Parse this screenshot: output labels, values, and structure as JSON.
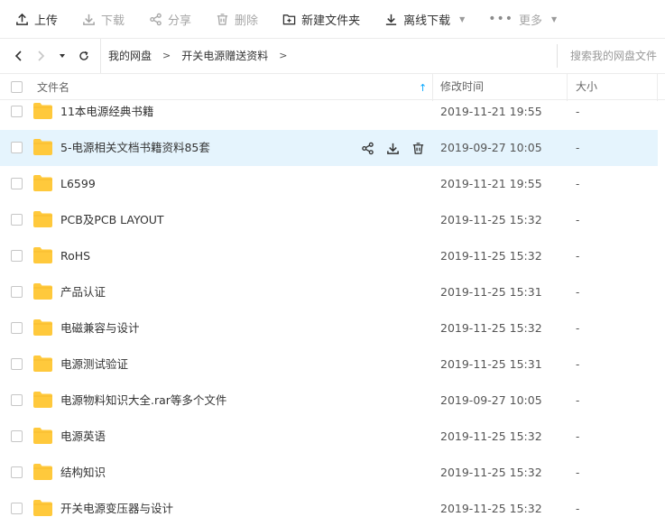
{
  "toolbar": {
    "upload": "上传",
    "download": "下载",
    "share": "分享",
    "delete": "删除",
    "new_folder": "新建文件夹",
    "offline_download": "离线下载",
    "more": "更多"
  },
  "nav": {
    "breadcrumb": [
      "我的网盘",
      "开关电源赠送资料"
    ],
    "search_placeholder": "搜索我的网盘文件"
  },
  "table": {
    "columns": {
      "name": "文件名",
      "mtime": "修改时间",
      "size": "大小"
    },
    "sort_arrow": "↑",
    "rows": [
      {
        "name": "11本电源经典书籍",
        "mtime": "2019-11-21 19:55",
        "size": "-"
      },
      {
        "name": "5-电源相关文档书籍资料85套",
        "mtime": "2019-09-27 10:05",
        "size": "-"
      },
      {
        "name": "L6599",
        "mtime": "2019-11-21 19:55",
        "size": "-"
      },
      {
        "name": "PCB及PCB LAYOUT",
        "mtime": "2019-11-25 15:32",
        "size": "-"
      },
      {
        "name": "RoHS",
        "mtime": "2019-11-25 15:32",
        "size": "-"
      },
      {
        "name": "产品认证",
        "mtime": "2019-11-25 15:31",
        "size": "-"
      },
      {
        "name": "电磁兼容与设计",
        "mtime": "2019-11-25 15:32",
        "size": "-"
      },
      {
        "name": "电源测试验证",
        "mtime": "2019-11-25 15:31",
        "size": "-"
      },
      {
        "name": "电源物料知识大全.rar等多个文件",
        "mtime": "2019-09-27 10:05",
        "size": "-"
      },
      {
        "name": "电源英语",
        "mtime": "2019-11-25 15:32",
        "size": "-"
      },
      {
        "name": "结构知识",
        "mtime": "2019-11-25 15:32",
        "size": "-"
      },
      {
        "name": "开关电源变压器与设计",
        "mtime": "2019-11-25 15:32",
        "size": "-"
      }
    ]
  },
  "colors": {
    "accent": "#06a7ff",
    "folder": "#ffc93c",
    "hover_row": "#e5f4fd"
  }
}
